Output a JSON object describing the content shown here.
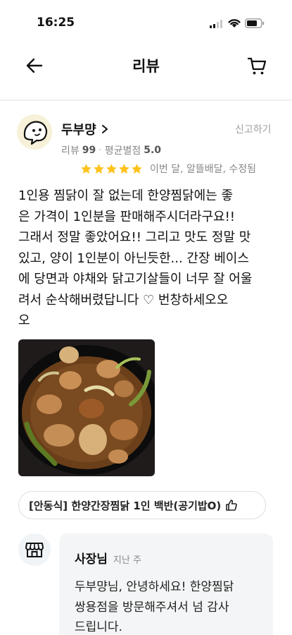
{
  "status_bar": {
    "time": "16:25",
    "icons": [
      "cellular-signal-icon",
      "wifi-icon",
      "battery-icon"
    ]
  },
  "nav": {
    "title": "리뷰",
    "back_icon": "arrow-left-icon",
    "cart_icon": "cart-icon"
  },
  "review": {
    "author": "두부먕",
    "report_label": "신고하기",
    "review_count_label": "리뷰",
    "review_count": "99",
    "avg_rating_label": "평균별점",
    "avg_rating": "5.0",
    "stars": 5,
    "meta": "이번 달, 알뜰배달, 수정됨",
    "text": "1인용 찜닭이 잘 없는데 한양찜닭에는 좋\n은 가격이 1인분을 판매해주시더라구요!!\n그래서 정말 좋았어요!! 그리고 맛도 정말 맛\n있고, 양이 1인분이 아닌듯한... 간장 베이스\n에 당면과 야채와 닭고기살들이 너무 잘 어울\n려서 순삭해버렸답니다 ♡ 번창하세오오\n오",
    "photo": "jjimdak-food-photo",
    "menu_item": "[안동식] 한양간장찜닭 1인 백반(공기밥O)"
  },
  "owner_reply": {
    "name": "사장님",
    "time": "지난 주",
    "text": "두부먕님,  안녕하세요! 한양찜닭\n쌍용점을 방문해주셔서 넘 감사\n드립니다."
  },
  "colors": {
    "star": "#ffc21b",
    "muted_text": "#888888",
    "reply_bg": "#f4f5f6"
  }
}
